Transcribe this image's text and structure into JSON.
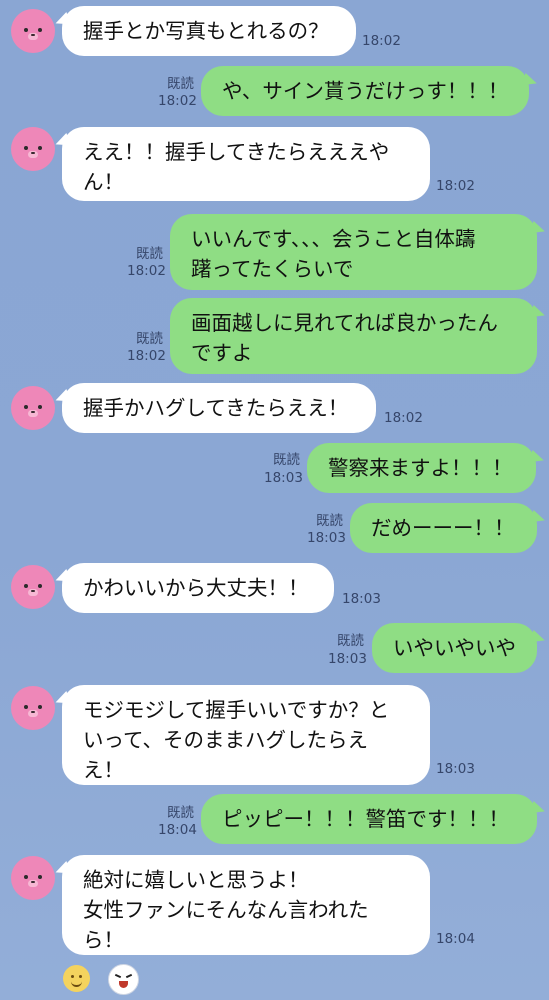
{
  "messages": [
    {
      "side": "in",
      "text": "握手とか写真もとれるの？",
      "time": "18:02"
    },
    {
      "side": "out",
      "text": "や、サイン貰うだけっす！！！",
      "time": "18:02",
      "read": "既読"
    },
    {
      "side": "in",
      "text": "ええ！！握手してきたらえええや\nん！",
      "time": "18:02"
    },
    {
      "side": "out",
      "text": "いいんです、、、会うこと自体躊\n躇ってたくらいで",
      "time": "18:02",
      "read": "既読"
    },
    {
      "side": "out",
      "text": "画面越しに見れてれば良かったん\nですよ",
      "time": "18:02",
      "read": "既読"
    },
    {
      "side": "in",
      "text": "握手かハグしてきたらええ！",
      "time": "18:02"
    },
    {
      "side": "out",
      "text": "警察来ますよ！！！",
      "time": "18:03",
      "read": "既読"
    },
    {
      "side": "out",
      "text": "だめーーー！！",
      "time": "18:03",
      "read": "既読"
    },
    {
      "side": "in",
      "text": "かわいいから大丈夫！！",
      "time": "18:03"
    },
    {
      "side": "out",
      "text": "いやいやいや",
      "time": "18:03",
      "read": "既読"
    },
    {
      "side": "in",
      "text": "モジモジして握手いいですか？と\nいって、そのままハグしたらえ\nえ！",
      "time": "18:03"
    },
    {
      "side": "out",
      "text": "ピッピー！！！警笛です！！！",
      "time": "18:04",
      "read": "既読"
    },
    {
      "side": "in",
      "text": "絶対に嬉しいと思うよ！\n女性ファンにそんなん言われた\nら！",
      "time": "18:04"
    }
  ],
  "icons": {
    "avatar": "pink-animal-avatar-icon",
    "emoji": "smile-emoji-icon",
    "sticker": "sticker-face-icon"
  },
  "colors": {
    "background": "#8aa6d3",
    "incoming_bubble": "#ffffff",
    "outgoing_bubble": "#8fdd84",
    "avatar": "#ee87b8"
  }
}
